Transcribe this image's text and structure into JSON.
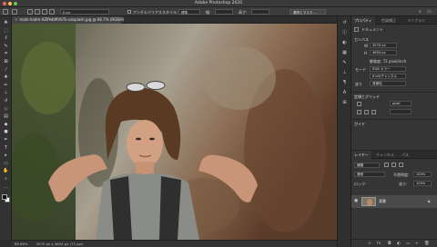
{
  "window": {
    "title": "Adobe Photoshop 2020"
  },
  "options_bar": {
    "field_value": "0 px",
    "anti_alias_label": "アンチエイリアス",
    "style_label": "スタイル:",
    "style_value": "標準",
    "width_label": "幅:",
    "height_label": "高さ:",
    "select_mask_button": "選択とマスク..."
  },
  "document": {
    "tab_title": "mats-hadm-AZIPebWVbTk-unsplash.jpg @ 66.7% (RGB/8)"
  },
  "status_bar": {
    "zoom": "66.66%",
    "info": "3070 px x 4604 px (72 ppi)"
  },
  "tools": [
    {
      "name": "move-tool-icon",
      "glyph": "✥"
    },
    {
      "name": "marquee-tool-icon",
      "glyph": "⬚"
    },
    {
      "name": "lasso-tool-icon",
      "glyph": "ℓ"
    },
    {
      "name": "quick-select-tool-icon",
      "glyph": "✎"
    },
    {
      "name": "crop-tool-icon",
      "glyph": "⌗"
    },
    {
      "name": "frame-tool-icon",
      "glyph": "⊠"
    },
    {
      "name": "eyedropper-tool-icon",
      "glyph": "⁄"
    },
    {
      "name": "healing-brush-tool-icon",
      "glyph": "✚"
    },
    {
      "name": "brush-tool-icon",
      "glyph": "✏"
    },
    {
      "name": "clone-stamp-tool-icon",
      "glyph": "⊥"
    },
    {
      "name": "history-brush-tool-icon",
      "glyph": "↺"
    },
    {
      "name": "eraser-tool-icon",
      "glyph": "◇"
    },
    {
      "name": "gradient-tool-icon",
      "glyph": "▤"
    },
    {
      "name": "blur-tool-icon",
      "glyph": "◆"
    },
    {
      "name": "dodge-tool-icon",
      "glyph": "●"
    },
    {
      "name": "pen-tool-icon",
      "glyph": "✒"
    },
    {
      "name": "type-tool-icon",
      "glyph": "T"
    },
    {
      "name": "path-select-tool-icon",
      "glyph": "▸"
    },
    {
      "name": "rectangle-tool-icon",
      "glyph": "▭"
    },
    {
      "name": "hand-tool-icon",
      "glyph": "✋"
    },
    {
      "name": "zoom-tool-icon",
      "glyph": "⌕"
    },
    {
      "name": "edit-toolbar-icon",
      "glyph": "…"
    }
  ],
  "panels": {
    "tabs": [
      "プロパティ",
      "色調補正",
      "ライブラリ"
    ],
    "properties": {
      "doc_label": "ドキュメント",
      "canvas_head": "カンバス",
      "width_label": "W",
      "width_value": "3070 px",
      "height_label": "H",
      "height_value": "4604 px",
      "resolution_value": "解像度: 72 pixel/inch",
      "mode_label": "モード",
      "mode_value": "RGB カラー",
      "bits_value": "8 bit/チャンネル",
      "fill_label": "塗り",
      "fill_value": "背景色",
      "rulers_head": "定規とグリッド",
      "units_value": "pixel",
      "guides_head": "ガイド"
    },
    "layers": {
      "tabs": [
        "レイヤー",
        "チャンネル",
        "パス"
      ],
      "kind_label": "種類",
      "mode_value": "通常",
      "opacity_label": "不透明度:",
      "opacity_value": "100%",
      "lock_label": "ロック:",
      "fill_label": "塗り:",
      "fill_value": "100%",
      "items": [
        {
          "name": "背景"
        }
      ]
    }
  }
}
